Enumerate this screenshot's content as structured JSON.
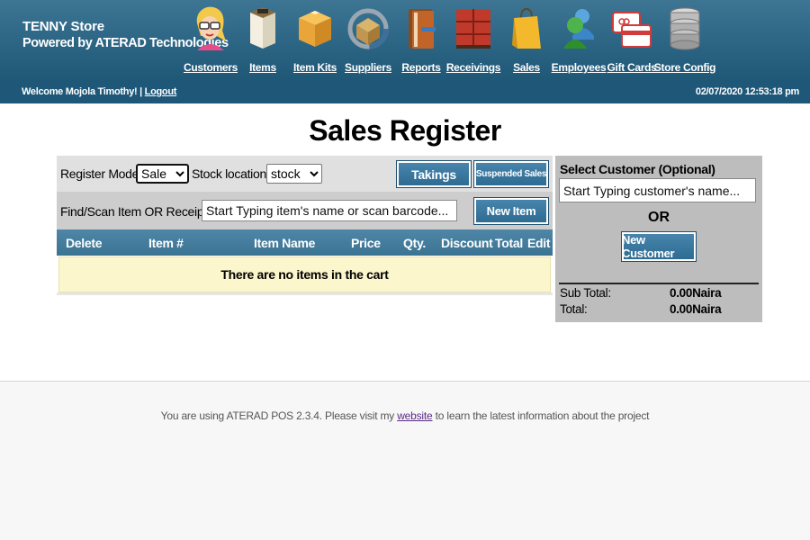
{
  "header": {
    "store_name": "TENNY Store",
    "powered_by": "Powered by ATERAD Technologies"
  },
  "nav": [
    {
      "label": "Customers",
      "icon": "customers-icon"
    },
    {
      "label": "Items",
      "icon": "items-icon"
    },
    {
      "label": "Item Kits",
      "icon": "item-kits-icon"
    },
    {
      "label": "Suppliers",
      "icon": "suppliers-icon"
    },
    {
      "label": "Reports",
      "icon": "reports-icon"
    },
    {
      "label": "Receivings",
      "icon": "receivings-icon"
    },
    {
      "label": "Sales",
      "icon": "sales-icon"
    },
    {
      "label": "Employees",
      "icon": "employees-icon"
    },
    {
      "label": "Gift Cards",
      "icon": "gift-cards-icon"
    },
    {
      "label": "Store Config",
      "icon": "store-config-icon"
    }
  ],
  "welcome": {
    "text": "Welcome Mojola Timothy! | ",
    "logout": "Logout",
    "datetime": "02/07/2020 12:53:18 pm"
  },
  "page_title": "Sales Register",
  "register": {
    "mode_label": "Register Mode",
    "mode_value": "Sale",
    "stock_label": "Stock location",
    "stock_value": "stock",
    "takings_label": "Takings",
    "suspended_label": "Suspended Sales",
    "find_label": "Find/Scan Item OR Receipt",
    "item_placeholder": "Start Typing item's name or scan barcode...",
    "new_item_label": "New Item"
  },
  "cart": {
    "columns": [
      "Delete",
      "Item #",
      "Item Name",
      "Price",
      "Qty.",
      "Discount",
      "Total",
      "Edit"
    ],
    "empty_message": "There are no items in the cart"
  },
  "customer": {
    "title": "Select Customer (Optional)",
    "placeholder": "Start Typing customer's name...",
    "or_label": "OR",
    "new_customer_label": "New Customer",
    "subtotal_label": "Sub Total:",
    "subtotal_value": "0.00Naira",
    "total_label": "Total:",
    "total_value": "0.00Naira"
  },
  "footer": {
    "prefix": "You are using ATERAD POS 2.3.4. Please visit my ",
    "link": "website",
    "suffix": " to learn the latest information about the project"
  }
}
